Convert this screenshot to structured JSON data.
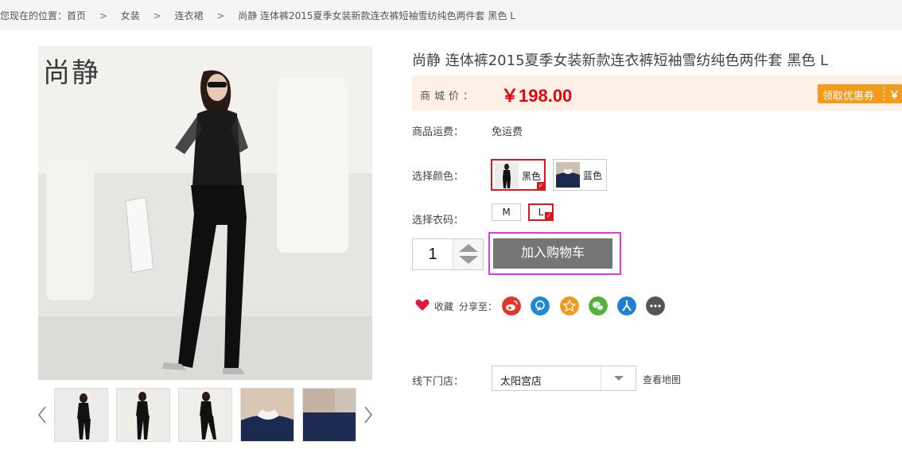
{
  "breadcrumb": {
    "prefix": "您现在的位置：首页",
    "sep": ">",
    "items": [
      "女装",
      "连衣裙",
      "尚静 连体裤2015夏季女装新款连衣裤短袖雪纺纯色两件套 黑色 L"
    ]
  },
  "gallery": {
    "brand_mark": "尚静",
    "thumbnail_count": 5
  },
  "product": {
    "title": "尚静 连体裤2015夏季女装新款连衣裤短袖雪纺纯色两件套 黑色 L",
    "price_label": "商城价：",
    "price": "￥198.00",
    "coupon_label": "领取优惠券",
    "coupon_symbol": "￥"
  },
  "shipping": {
    "label": "商品运费：",
    "value": "免运费"
  },
  "color": {
    "label": "选择颜色：",
    "options": [
      {
        "name": "黑色",
        "selected": true
      },
      {
        "name": "蓝色",
        "selected": false
      }
    ]
  },
  "size": {
    "label": "选择衣码：",
    "options": [
      {
        "name": "M",
        "selected": false
      },
      {
        "name": "L",
        "selected": true
      }
    ]
  },
  "quantity": {
    "value": "1"
  },
  "cart": {
    "label": "加入购物车"
  },
  "social": {
    "favorite_label": "收藏",
    "share_label": "分享至：",
    "icons": [
      "weibo-icon",
      "tencent-weibo-icon",
      "qzone-icon",
      "wechat-icon",
      "renren-icon",
      "more-icon"
    ]
  },
  "store": {
    "label": "线下门店：",
    "value": "太阳宫店",
    "map_link": "查看地图"
  },
  "colors": {
    "price_red": "#e4060d",
    "price_bg": "#fdf0e6",
    "coupon_orange": "#f39b1d",
    "cart_gray": "#757575",
    "highlight_magenta": "#e33ae0",
    "selected_red": "#e0161e",
    "share_colors": [
      "#e2352a",
      "#1e88d2",
      "#f39a1e",
      "#4eb43a",
      "#1f7fd6",
      "#555555"
    ]
  }
}
